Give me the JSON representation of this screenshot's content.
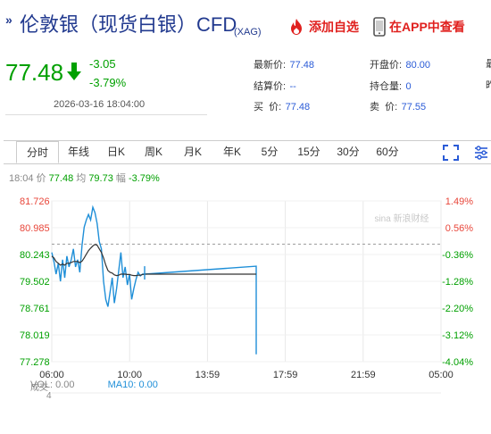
{
  "header": {
    "title_prefix": "»",
    "title": "伦敦银（现货白银）CFD",
    "title_sub": "(XAG)",
    "fav_label": "添加自选",
    "app_label": "在APP中查看"
  },
  "quote": {
    "price": "77.48",
    "change": "-3.05",
    "change_pct": "-3.79%",
    "timestamp": "2026-03-16 18:04:00",
    "trend_color": "#00a000"
  },
  "stats": {
    "latest_label": "最新价:",
    "latest": "77.48",
    "settle_label": "结算价:",
    "settle": "--",
    "buy_label": "买  价:",
    "buy": "77.48",
    "open_label": "开盘价:",
    "open": "80.00",
    "position_label": "持仓量:",
    "position": "0",
    "sell_label": "卖  价:",
    "sell": "77.55",
    "extra1": "最",
    "extra2": "昨"
  },
  "tabs": [
    {
      "label": "分时",
      "active": true
    },
    {
      "label": "年线"
    },
    {
      "label": "日K"
    },
    {
      "label": "周K"
    },
    {
      "label": "月K"
    },
    {
      "label": "年K"
    },
    {
      "label": "5分"
    },
    {
      "label": "15分"
    },
    {
      "label": "30分"
    },
    {
      "label": "60分"
    }
  ],
  "ticker": {
    "time": "18:04",
    "price_label": "价",
    "price": "77.48",
    "avg_label": "均",
    "avg": "79.73",
    "amp_label": "幅",
    "amp": "-3.79%"
  },
  "watermark": "sina 新浪财经",
  "volume": {
    "label": "成交",
    "sub": "4",
    "vol_label": "VOL: 0.00",
    "ma_label": "MA10: 0.00"
  },
  "colors": {
    "up": "#e8463a",
    "down": "#00a000",
    "accent": "#2a5bd7",
    "price_line": "#1f8fd8",
    "avg_line": "#333333"
  },
  "chart_data": {
    "type": "line",
    "y_ticks": [
      "81.726",
      "80.985",
      "80.243",
      "79.502",
      "78.761",
      "78.019",
      "77.278"
    ],
    "pct_ticks": [
      "1.49%",
      "0.56%",
      "-0.36%",
      "-1.28%",
      "-2.20%",
      "-3.12%",
      "-4.04%"
    ],
    "x_ticks": [
      "06:00",
      "10:00",
      "13:59",
      "17:59",
      "21:59",
      "05:00"
    ],
    "ylim": [
      77.278,
      81.726
    ],
    "prev_close": 80.53,
    "series": [
      {
        "values": [
          80.3,
          80.05,
          79.7,
          80.0,
          79.5,
          80.1,
          79.6,
          80.2,
          79.9,
          80.1,
          80.4,
          79.9,
          80.1,
          79.75,
          80.5,
          81.0,
          81.2,
          81.35,
          81.2,
          81.55,
          81.4,
          81.1,
          80.6,
          80.4,
          79.5,
          79.0,
          78.8,
          79.2,
          79.6,
          78.9,
          79.3,
          79.8,
          80.3,
          79.6,
          79.9,
          79.4,
          79.7,
          79.0,
          79.3,
          79.55,
          79.75,
          79.65,
          79.7,
          79.7,
          79.7,
          79.7,
          79.7,
          77.48
        ]
      },
      {
        "values": [
          80.2,
          80.15,
          80.05,
          80.0,
          79.95,
          79.98,
          79.95,
          80.0,
          80.0,
          80.02,
          80.05,
          80.05,
          80.05,
          80.02,
          80.06,
          80.15,
          80.25,
          80.35,
          80.42,
          80.48,
          80.52,
          80.5,
          80.4,
          80.3,
          80.15,
          79.95,
          79.8,
          79.75,
          79.73,
          79.68,
          79.66,
          79.67,
          79.7,
          79.7,
          79.7,
          79.69,
          79.69,
          79.67,
          79.66,
          79.66,
          79.67,
          79.67,
          79.69,
          79.7,
          79.71,
          79.72,
          79.73,
          79.73
        ]
      }
    ]
  }
}
